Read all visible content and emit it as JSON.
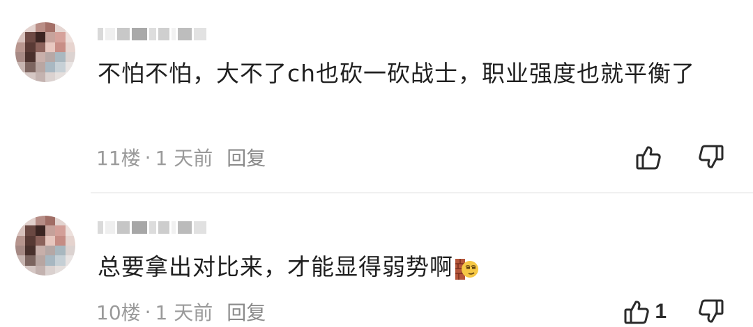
{
  "comments": [
    {
      "floor": "11楼",
      "time": "1 天前",
      "reply_label": "回复",
      "dot": "·",
      "text": "不怕不怕，大不了ch也砍一砍战士，职业强度也就平衡了",
      "like_count": "",
      "avatar_icon": "pixelated-avatar",
      "username_masked": true
    },
    {
      "floor": "10楼",
      "time": "1 天前",
      "reply_label": "回复",
      "dot": "·",
      "text": "总要拿出对比来，才能显得弱势啊",
      "emoji": "wall-peek-emoji",
      "like_count": "1",
      "avatar_icon": "pixelated-avatar",
      "username_masked": true
    }
  ],
  "colors": {
    "text": "#1f1f1f",
    "meta": "#9a9a9a",
    "divider": "#f0f0f0",
    "icon": "#2a2a2a"
  }
}
